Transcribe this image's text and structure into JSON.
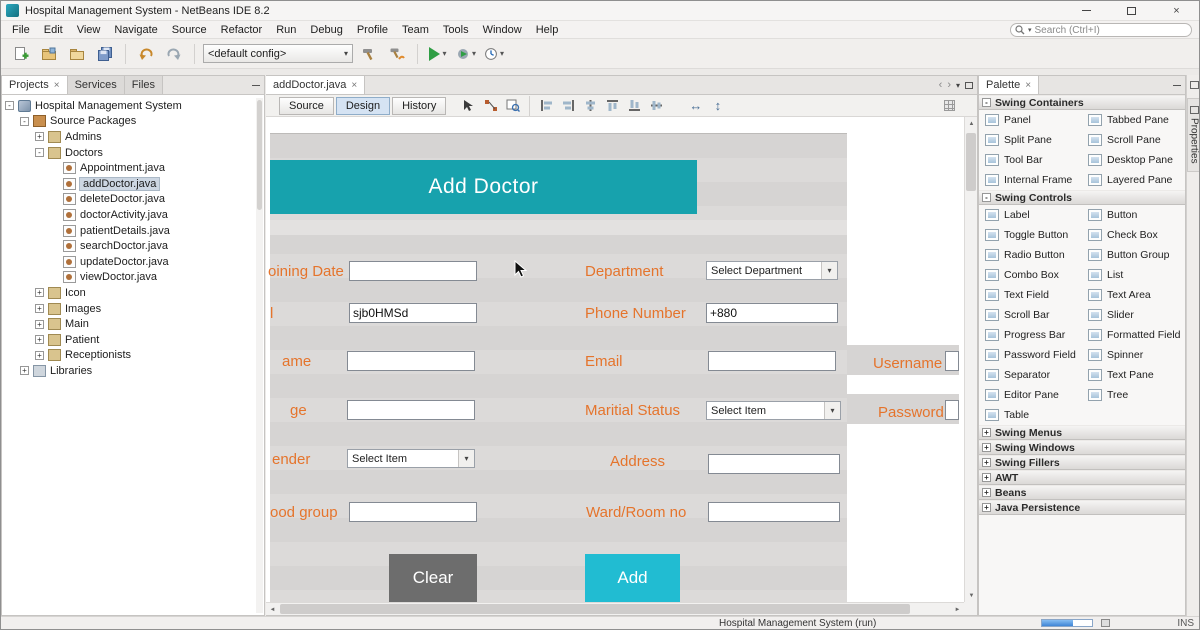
{
  "window": {
    "title": "Hospital Management System - NetBeans IDE 8.2",
    "close_glyph": "×"
  },
  "menubar": {
    "items": [
      "File",
      "Edit",
      "View",
      "Navigate",
      "Source",
      "Refactor",
      "Run",
      "Debug",
      "Profile",
      "Team",
      "Tools",
      "Window",
      "Help"
    ]
  },
  "search": {
    "placeholder": "Search (Ctrl+I)"
  },
  "toolbar": {
    "config": "<default config>"
  },
  "ui_glyphs": {
    "dropdown": "▾",
    "tab_close": "×",
    "minimize": "–",
    "nav_left": "‹",
    "nav_right": "›",
    "scroll_up": "▲",
    "scroll_down": "▼",
    "scroll_left": "◄",
    "scroll_right": "►",
    "h_resize": "↔",
    "v_resize": "↕"
  },
  "left_panel": {
    "tabs": [
      "Projects",
      "Services",
      "Files"
    ],
    "tree": [
      {
        "label": "Hospital Management System",
        "exp": "-"
      },
      {
        "label": "Source Packages",
        "exp": "-"
      },
      {
        "label": "Admins",
        "exp": "+"
      },
      {
        "label": "Doctors",
        "exp": "-"
      },
      {
        "label": "Appointment.java",
        "exp": ""
      },
      {
        "label": "addDoctor.java",
        "exp": ""
      },
      {
        "label": "deleteDoctor.java",
        "exp": ""
      },
      {
        "label": "doctorActivity.java",
        "exp": ""
      },
      {
        "label": "patientDetails.java",
        "exp": ""
      },
      {
        "label": "searchDoctor.java",
        "exp": ""
      },
      {
        "label": "updateDoctor.java",
        "exp": ""
      },
      {
        "label": "viewDoctor.java",
        "exp": ""
      },
      {
        "label": "Icon",
        "exp": "+"
      },
      {
        "label": "Images",
        "exp": "+"
      },
      {
        "label": "Main",
        "exp": "+"
      },
      {
        "label": "Patient",
        "exp": "+"
      },
      {
        "label": "Receptionists",
        "exp": "+"
      },
      {
        "label": "Libraries",
        "exp": "+"
      }
    ]
  },
  "editor": {
    "tab": {
      "label": "addDoctor.java"
    },
    "views": {
      "source": "Source",
      "design": "Design",
      "history": "History"
    },
    "form": {
      "title": "Add Doctor",
      "labels": {
        "joining_date": "oining Date",
        "id": "l",
        "name": "ame",
        "age": "ge",
        "gender": "ender",
        "blood_group": "ood group",
        "department": "Department",
        "phone": "Phone Number",
        "email": "Email",
        "marital": "Maritial Status",
        "address": "Address",
        "ward": "Ward/Room no",
        "username": "Username",
        "password": "Password"
      },
      "values": {
        "id": "sjb0HMSd",
        "phone": "+880",
        "department": "Select Department",
        "marital": "Select Item",
        "gender": "Select Item"
      },
      "buttons": {
        "clear": "Clear",
        "add": "Add"
      }
    }
  },
  "palette": {
    "tab": "Palette",
    "sections": [
      {
        "title": "Swing Containers",
        "glyph": "-",
        "items": [
          "Panel",
          "Tabbed Pane",
          "Split Pane",
          "Scroll Pane",
          "Tool Bar",
          "Desktop Pane",
          "Internal Frame",
          "Layered Pane"
        ]
      },
      {
        "title": "Swing Controls",
        "glyph": "-",
        "items": [
          "Label",
          "Button",
          "Toggle Button",
          "Check Box",
          "Radio Button",
          "Button Group",
          "Combo Box",
          "List",
          "Text Field",
          "Text Area",
          "Scroll Bar",
          "Slider",
          "Progress Bar",
          "Formatted Field",
          "Password Field",
          "Spinner",
          "Separator",
          "Text Pane",
          "Editor Pane",
          "Tree",
          "Table"
        ]
      },
      {
        "title": "Swing Menus",
        "glyph": "+"
      },
      {
        "title": "Swing Windows",
        "glyph": "+"
      },
      {
        "title": "Swing Fillers",
        "glyph": "+"
      },
      {
        "title": "AWT",
        "glyph": "+"
      },
      {
        "title": "Beans",
        "glyph": "+"
      },
      {
        "title": "Java Persistence",
        "glyph": "+"
      }
    ]
  },
  "properties_tab": "Properties",
  "statusbar": {
    "run_text": "Hospital Management System (run)",
    "ins": "INS"
  }
}
